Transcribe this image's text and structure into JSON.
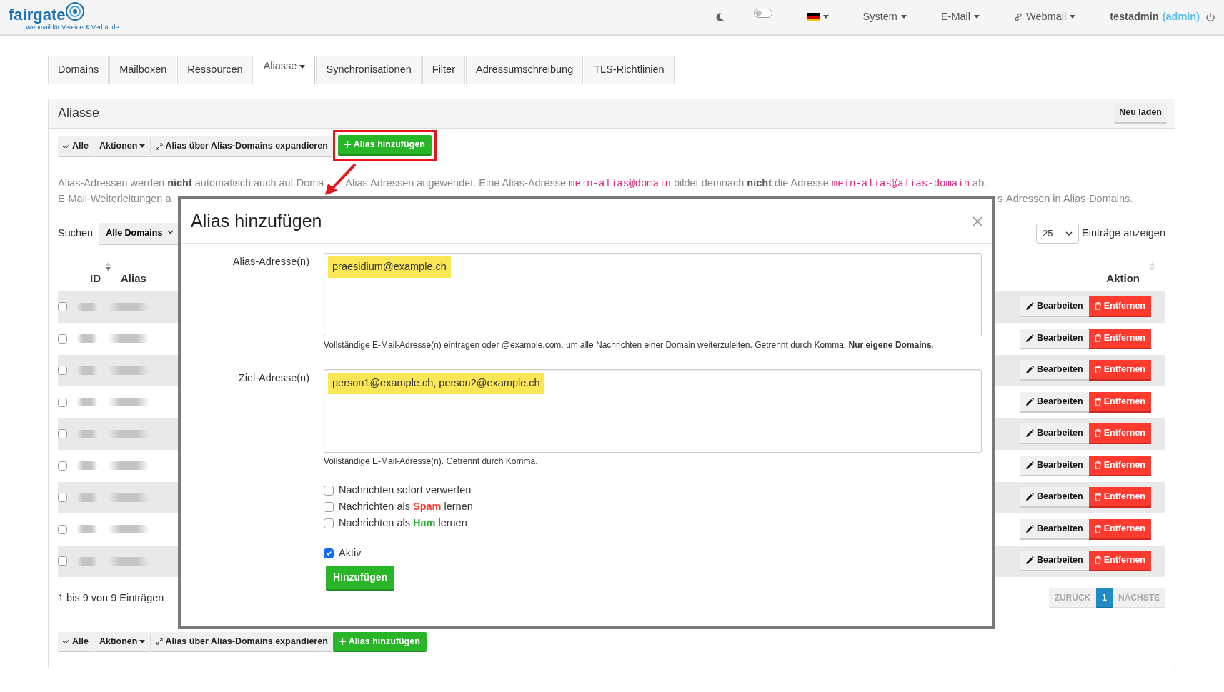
{
  "navbar": {
    "logo": "fairgate",
    "tagline": "Webmail für Vereine & Verbände",
    "dark_mode": false,
    "menus": [
      {
        "kind": "flag"
      },
      {
        "kind": "menu",
        "label": "System"
      },
      {
        "kind": "menu",
        "label": "E-Mail"
      },
      {
        "kind": "link",
        "label": "Webmail"
      }
    ],
    "user": "testadmin",
    "role": "(admin)"
  },
  "tabs": [
    {
      "label": "Domains",
      "selected": false,
      "dropdown": false
    },
    {
      "label": "Mailboxen",
      "selected": false,
      "dropdown": false
    },
    {
      "label": "Ressourcen",
      "selected": false,
      "dropdown": false
    },
    {
      "label": "Aliasse",
      "selected": true,
      "dropdown": true
    },
    {
      "label": "Synchronisationen",
      "selected": false,
      "dropdown": false
    },
    {
      "label": "Filter",
      "selected": false,
      "dropdown": false
    },
    {
      "label": "Adressumschreibung",
      "selected": false,
      "dropdown": false
    },
    {
      "label": "TLS-Richtlinien",
      "selected": false,
      "dropdown": false
    }
  ],
  "panel": {
    "title": "Aliasse",
    "reload": "Neu laden",
    "toolbar": [
      {
        "kind": "check",
        "label": "Alle"
      },
      {
        "kind": "dropdown",
        "label": "Aktionen"
      },
      {
        "kind": "expand",
        "label": "Alias über Alias-Domains expandieren"
      },
      {
        "kind": "add",
        "label": "Alias hinzufügen",
        "highlighted": true
      }
    ],
    "description": [
      {
        "kind": "text",
        "text": "Alias-Adressen werden "
      },
      {
        "kind": "bold",
        "text": "nicht"
      },
      {
        "kind": "text",
        "text": " automatisch auch auf Doma"
      },
      {
        "kind": "after_gap",
        "text": "Alias Adressen angewendet. Eine Alias-Adresse "
      },
      {
        "kind": "code",
        "text": "mein-alias@domain"
      },
      {
        "kind": "text",
        "text": " bildet demnach "
      },
      {
        "kind": "bold",
        "text": "nicht"
      },
      {
        "kind": "text",
        "text": " die Adresse "
      },
      {
        "kind": "code",
        "text": "mein-alias@alias-domain"
      },
      {
        "kind": "text",
        "text": " ab."
      }
    ],
    "description_cut_start": "E-Mail-Weiterleitungen a",
    "description_cut_end": "s-Adressen in Alias-Domains.",
    "search": {
      "label": "Suchen",
      "filter": "Alle Domains"
    },
    "page_size": {
      "value": "25",
      "label": "Einträge anzeigen"
    },
    "table": {
      "columns": [
        {
          "label": "ID",
          "sortable": true,
          "sorted_desc": true
        },
        {
          "label": "Alias"
        },
        {
          "label": "Aktion",
          "sortable": true,
          "sorted_desc": false
        }
      ],
      "rows": [
        {
          "checked": false,
          "edit": "Bearbeiten",
          "remove": "Entfernen"
        },
        {
          "checked": false,
          "edit": "Bearbeiten",
          "remove": "Entfernen"
        },
        {
          "checked": false,
          "edit": "Bearbeiten",
          "remove": "Entfernen"
        },
        {
          "checked": false,
          "edit": "Bearbeiten",
          "remove": "Entfernen"
        },
        {
          "checked": false,
          "edit": "Bearbeiten",
          "remove": "Entfernen"
        },
        {
          "checked": false,
          "edit": "Bearbeiten",
          "remove": "Entfernen"
        },
        {
          "checked": false,
          "edit": "Bearbeiten",
          "remove": "Entfernen"
        },
        {
          "checked": false,
          "edit": "Bearbeiten",
          "remove": "Entfernen"
        },
        {
          "checked": false,
          "edit": "Bearbeiten",
          "remove": "Entfernen"
        }
      ]
    },
    "info": "1 bis 9 von 9 Einträgen",
    "pagination": [
      {
        "label": "ZURÜCK",
        "selected": false,
        "disabled": true
      },
      {
        "label": "1",
        "selected": true,
        "disabled": false
      },
      {
        "label": "NÄCHSTE",
        "selected": false,
        "disabled": true
      }
    ],
    "bottom_toolbar": [
      {
        "kind": "check",
        "label": "Alle"
      },
      {
        "kind": "dropdown",
        "label": "Aktionen"
      },
      {
        "kind": "expand",
        "label": "Alias über Alias-Domains expandieren"
      },
      {
        "kind": "add",
        "label": "Alias hinzufügen",
        "highlighted": false
      }
    ]
  },
  "modal": {
    "title": "Alias hinzufügen",
    "fields": [
      {
        "label": "Alias-Adresse(n)",
        "value": "praesidium@example.ch",
        "highlighted": true,
        "help": "Vollständige E-Mail-Adresse(n) eintragen oder @example.com, um alle Nachrichten einer Domain weiterzuleiten. Getrennt durch Komma. **Nur eigene Domains**."
      },
      {
        "label": "Ziel-Adresse(n)",
        "value": "person1@example.ch, person2@example.ch",
        "highlighted": true,
        "help": "Vollständige E-Mail-Adresse(n). Getrennt durch Komma."
      }
    ],
    "options": [
      {
        "kind": "plain",
        "checked": false,
        "parts": [
          {
            "text": "Nachrichten sofort verwerfen"
          }
        ]
      },
      {
        "kind": "plain",
        "checked": false,
        "parts": [
          {
            "text": "Nachrichten als "
          },
          {
            "text": "Spam",
            "color": "#ff3b30"
          },
          {
            "text": " lernen"
          }
        ]
      },
      {
        "kind": "plain",
        "checked": false,
        "parts": [
          {
            "text": "Nachrichten als "
          },
          {
            "text": "Ham",
            "color": "#22b02e"
          },
          {
            "text": " lernen"
          }
        ]
      },
      {
        "kind": "spaced",
        "checked": true,
        "parts": [
          {
            "text": "Aktiv"
          }
        ]
      }
    ],
    "submit": "Hinzufügen"
  }
}
